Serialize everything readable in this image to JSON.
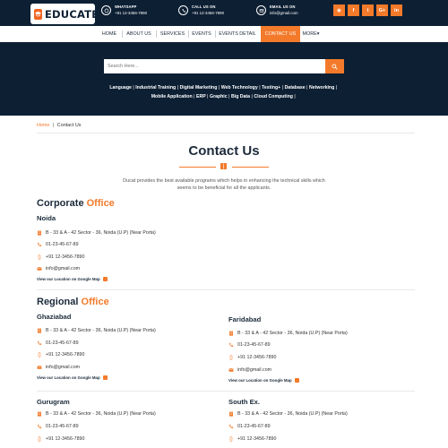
{
  "brand": {
    "name": "EDUCATE"
  },
  "header": {
    "whatsapp": {
      "label": "WHATSAPP",
      "value": "+91 12-3456-7890",
      "icon": "whatsapp-icon"
    },
    "call": {
      "label": "CALL US ON",
      "value": "+91 12-3456-7890",
      "icon": "phone-icon"
    },
    "email": {
      "label": "EMAIL US ON",
      "value": "info@gmail.com",
      "icon": "mail-icon"
    },
    "social": [
      "rss-icon",
      "facebook-icon",
      "twitter-icon",
      "google-plus-icon",
      "linkedin-icon"
    ]
  },
  "social_glyphs": {
    "rss": "◉",
    "facebook": "f",
    "twitter": "t",
    "google": "G+",
    "linkedin": "in"
  },
  "nav": {
    "items": [
      "HOME",
      "ABOUT US",
      "SERVICES",
      "EVENTS",
      "EVENTS DETAIL",
      "CONTACT US",
      "MORE"
    ],
    "active": "CONTACT US",
    "more_caret": "▾"
  },
  "search": {
    "placeholder": "Search Here..."
  },
  "tags": {
    "line1": [
      "Language",
      "Industrial Training",
      "Digital Marketing",
      "Web Technology",
      "Testing+",
      "Database",
      "Networking"
    ],
    "line2": [
      "Mobile Application",
      "ERP",
      "Graphic",
      "Big Data",
      "Cloud Computing"
    ]
  },
  "breadcrumb": {
    "home": "Home",
    "separator": "|",
    "current": "Contact Us"
  },
  "page": {
    "title": "Contact Us",
    "intro": "Ducat provides the best available programs which helps in enhancing the technical skills which seems to be beneficial for all the applicants."
  },
  "corporate": {
    "title_main": "Corporate",
    "title_accent": "Office",
    "city": "Noida",
    "address": "B - 33 & A - 42 Sector - 36, Noida (U.P) (Near Porta)",
    "phone": "01-23-45-67-89",
    "mobile": "+91 12-3456-7890",
    "email": "info@gmail.com",
    "map_link": "View our Location on Google Map"
  },
  "regional": {
    "title_main": "Regional",
    "title_accent": "Office",
    "offices": [
      {
        "city": "Ghaziabad",
        "address": "B - 33 & A - 42 Sector - 36, Noida (U.P) (Near Porta)",
        "phone": "01-23-45-67-89",
        "mobile": "+91 12-3456-7890",
        "email": "info@gmail.com",
        "map_link": "View our Location on Google Map"
      },
      {
        "city": "Faridabad",
        "address": "B - 33 & A - 42 Sector - 36, Noida (U.P) (Near Porta)",
        "phone": "01-23-45-67-89",
        "mobile": "+91 12-3456-7890",
        "email": "info@gmail.com",
        "map_link": "View our Location on Google Map"
      },
      {
        "city": "Gurugram",
        "address": "B - 33 & A - 42 Sector - 36, Noida (U.P) (Near Porta)",
        "phone": "01-23-45-67-89",
        "mobile": "+91 12-3456-7890"
      },
      {
        "city": "South Ex.",
        "address": "B - 33 & A - 42 Sector - 36, Noida (U.P) (Near Porta)",
        "phone": "01-23-45-67-89",
        "mobile": "+91 12-3456-7890"
      }
    ]
  },
  "colors": {
    "navy": "#0d1f33",
    "accent": "#f37a2a",
    "text": "#1b2a3a"
  }
}
